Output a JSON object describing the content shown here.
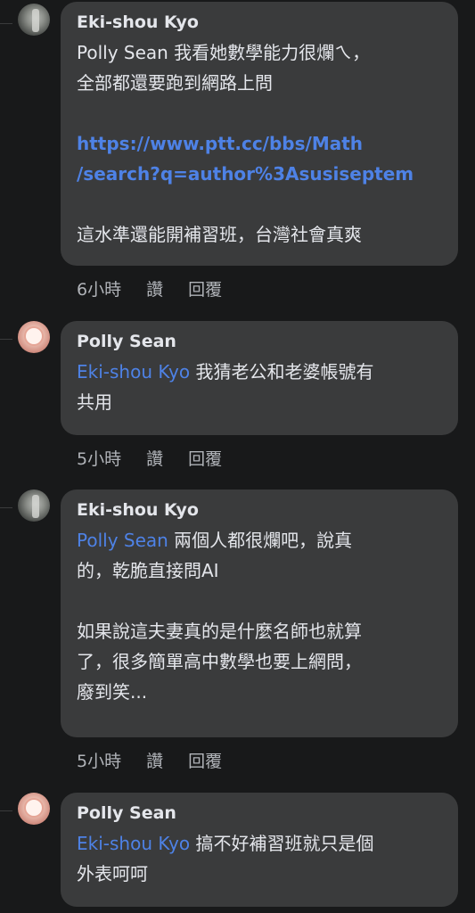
{
  "comments": [
    {
      "author": "Eki-shou Kyo",
      "mention": "Polly Sean",
      "text_line1": " 我看她數學能力很爛ㄟ，",
      "text_line2": "全部都還要跑到網路上問",
      "link_line1": "https://www.ptt.cc/bbs/Math",
      "link_line2": "/search?q=author%3Asusiseptem",
      "text_line3": "這水準還能開補習班，台灣社會真爽",
      "time": "6小時",
      "like": "讚",
      "reply": "回覆"
    },
    {
      "author": "Polly Sean",
      "mention": "Eki-shou Kyo",
      "text_line1": " 我猜老公和老婆帳號有",
      "text_line2": "共用",
      "time": "5小時",
      "like": "讚",
      "reply": "回覆"
    },
    {
      "author": "Eki-shou Kyo",
      "mention": "Polly Sean",
      "text_line1": " 兩個人都很爛吧，說真",
      "text_line2": "的，乾脆直接問AI",
      "text_line3": "如果說這夫妻真的是什麼名師也就算",
      "text_line4": "了，很多簡單高中數學也要上網問，",
      "text_line5": "廢到笑...",
      "time": "5小時",
      "like": "讚",
      "reply": "回覆"
    },
    {
      "author": "Polly Sean",
      "mention": "Eki-shou Kyo",
      "text_line1": " 搞不好補習班就只是個",
      "text_line2": "外表呵呵"
    }
  ]
}
